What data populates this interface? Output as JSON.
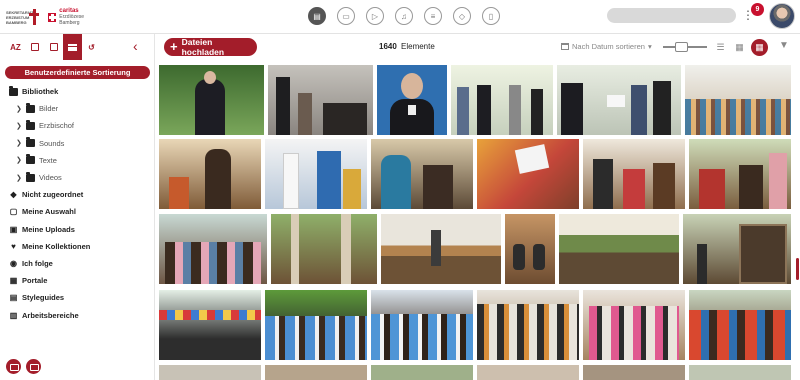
{
  "header": {
    "logo_left_text": "SEKRETARIAT ERZBISTUM BAMBERG",
    "logo_right_title": "caritas",
    "logo_right_sub": "Erzdiözese Bamberg",
    "type_icons": [
      "document-icon",
      "image-icon",
      "video-icon",
      "audio-icon",
      "text-icon",
      "shield-icon",
      "file-icon"
    ],
    "search_placeholder": "",
    "notification_count": "9"
  },
  "sidebar": {
    "tools": [
      "AZ",
      "calendar-icon",
      "box-icon",
      "list-icon",
      "reset-icon"
    ],
    "sort_button": "Benutzerdefinierte Sortierung",
    "tree": [
      {
        "label": "Bibliothek",
        "icon": "folder-icon",
        "level": 0
      },
      {
        "label": "Bilder",
        "icon": "folder-icon",
        "level": 1
      },
      {
        "label": "Erzbischof",
        "icon": "folder-icon",
        "level": 1
      },
      {
        "label": "Sounds",
        "icon": "folder-icon",
        "level": 1
      },
      {
        "label": "Texte",
        "icon": "folder-icon",
        "level": 1
      },
      {
        "label": "Videos",
        "icon": "folder-icon",
        "level": 1
      },
      {
        "label": "Nicht zugeordnet",
        "icon": "tag-icon",
        "level": 0
      },
      {
        "label": "Meine Auswahl",
        "icon": "clipboard-icon",
        "level": 0
      },
      {
        "label": "Meine Uploads",
        "icon": "upload-icon",
        "level": 0
      },
      {
        "label": "Meine Kollektionen",
        "icon": "heart-icon",
        "level": 0
      },
      {
        "label": "Ich folge",
        "icon": "eye-icon",
        "level": 0
      },
      {
        "label": "Portale",
        "icon": "grid-icon",
        "level": 0
      },
      {
        "label": "Styleguides",
        "icon": "styleguide-icon",
        "level": 0
      },
      {
        "label": "Arbeitsbereiche",
        "icon": "workspace-icon",
        "level": 0
      }
    ]
  },
  "main": {
    "upload_label": "Dateien hochladen",
    "count": "1640",
    "count_label": "Elemente",
    "sort_label": "Nach Datum sortieren"
  },
  "colors": {
    "accent": "#a31d2a"
  }
}
